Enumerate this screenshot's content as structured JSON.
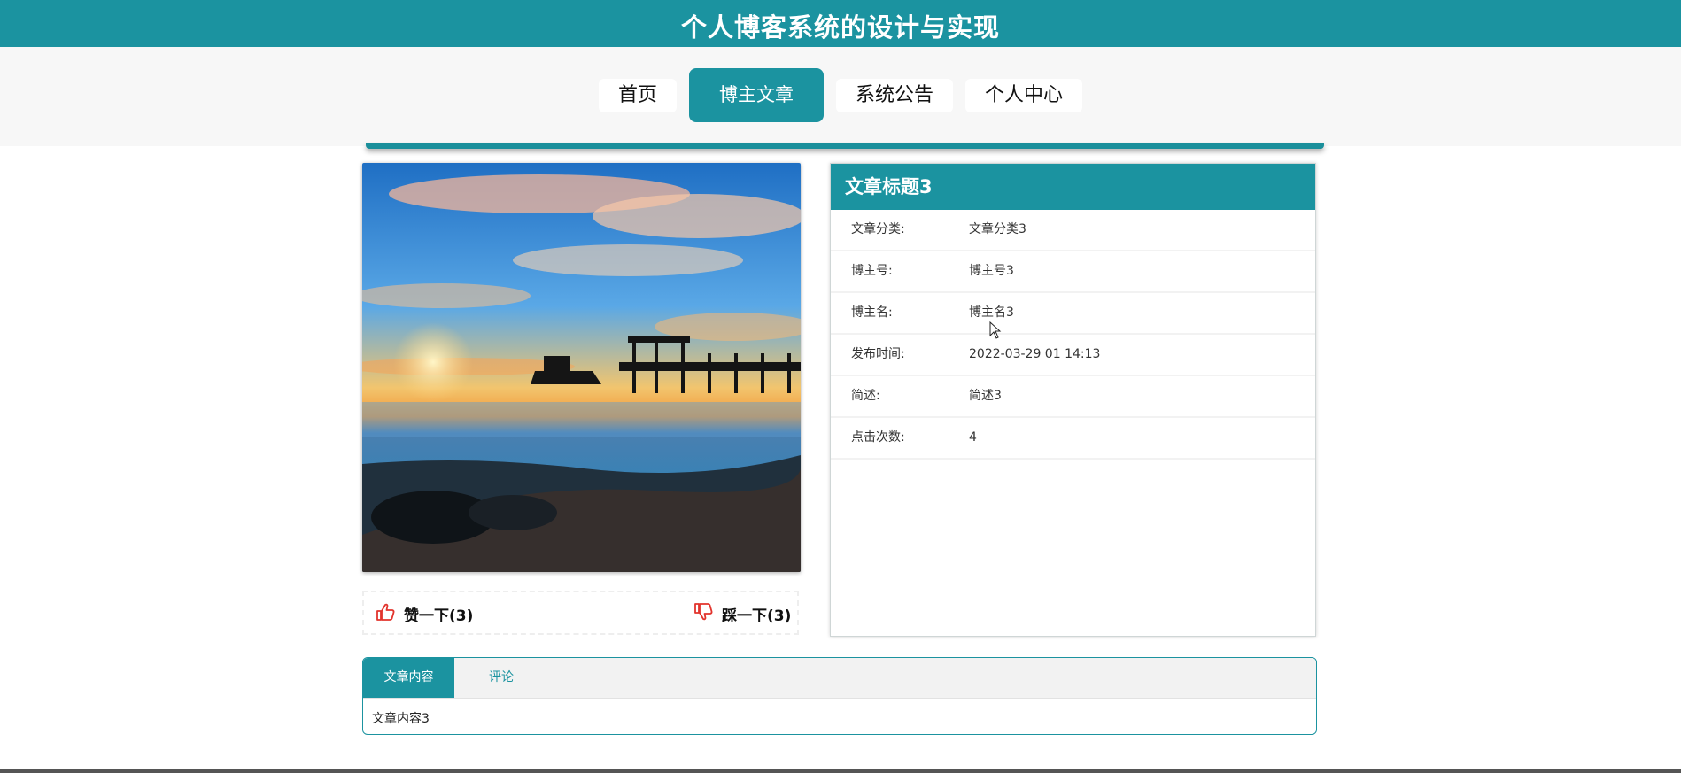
{
  "header": {
    "title": "个人博客系统的设计与实现"
  },
  "nav": {
    "items": [
      {
        "label": "首页"
      },
      {
        "label": "博主文章"
      },
      {
        "label": "系统公告"
      },
      {
        "label": "个人中心"
      }
    ],
    "active_index": 1
  },
  "votes": {
    "like_label": "赞一下(3)",
    "dislike_label": "踩一下(3)"
  },
  "article": {
    "title": "文章标题3",
    "fields": [
      {
        "label": "文章分类:",
        "value": "文章分类3"
      },
      {
        "label": "博主号:",
        "value": "博主号3"
      },
      {
        "label": "博主名:",
        "value": "博主名3"
      },
      {
        "label": "发布时间:",
        "value": "2022-03-29 01 14:13"
      },
      {
        "label": "简述:",
        "value": "简述3"
      },
      {
        "label": "点击次数:",
        "value": "4"
      }
    ]
  },
  "tabs": {
    "items": [
      {
        "label": "文章内容"
      },
      {
        "label": "评论"
      }
    ],
    "content": "文章内容3"
  },
  "colors": {
    "primary": "#1b93a0",
    "nav_bg": "#f7f7f7",
    "icon_red": "#e2342d"
  },
  "icons": {
    "like": "thumbs-up-icon",
    "dislike": "thumbs-down-icon"
  }
}
